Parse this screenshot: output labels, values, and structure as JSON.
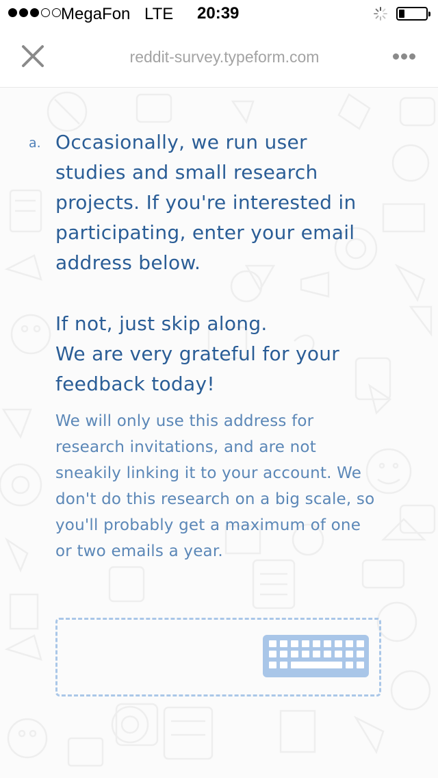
{
  "status_bar": {
    "carrier": "MegaFon",
    "network": "LTE",
    "time": "20:39",
    "signal_bars_filled": 3,
    "signal_bars_total": 5,
    "battery_level": 0.2
  },
  "browser": {
    "url": "reddit-survey.typeform.com",
    "close_icon": "close-icon",
    "more_icon": "more-options-icon"
  },
  "survey": {
    "question_letter": "a.",
    "question_text": "Occasionally, we run user\nstudies and small research\nprojects. If you're interested in\nparticipating, enter your email\naddress below.",
    "question_followup": "If not, just skip along.\nWe are very grateful for your\nfeedback today!",
    "description": "We will only use this address for research invitations, and are not sneakily linking it to your account.  We don't do this research on a big scale, so you'll probably get a maximum of one or two emails a year.",
    "input_value": "",
    "keyboard_icon": "keyboard-icon"
  },
  "colors": {
    "question": "#2a5d96",
    "description": "#5b87b7",
    "answer_border": "#aac7e8",
    "background": "#fbfbfb"
  }
}
